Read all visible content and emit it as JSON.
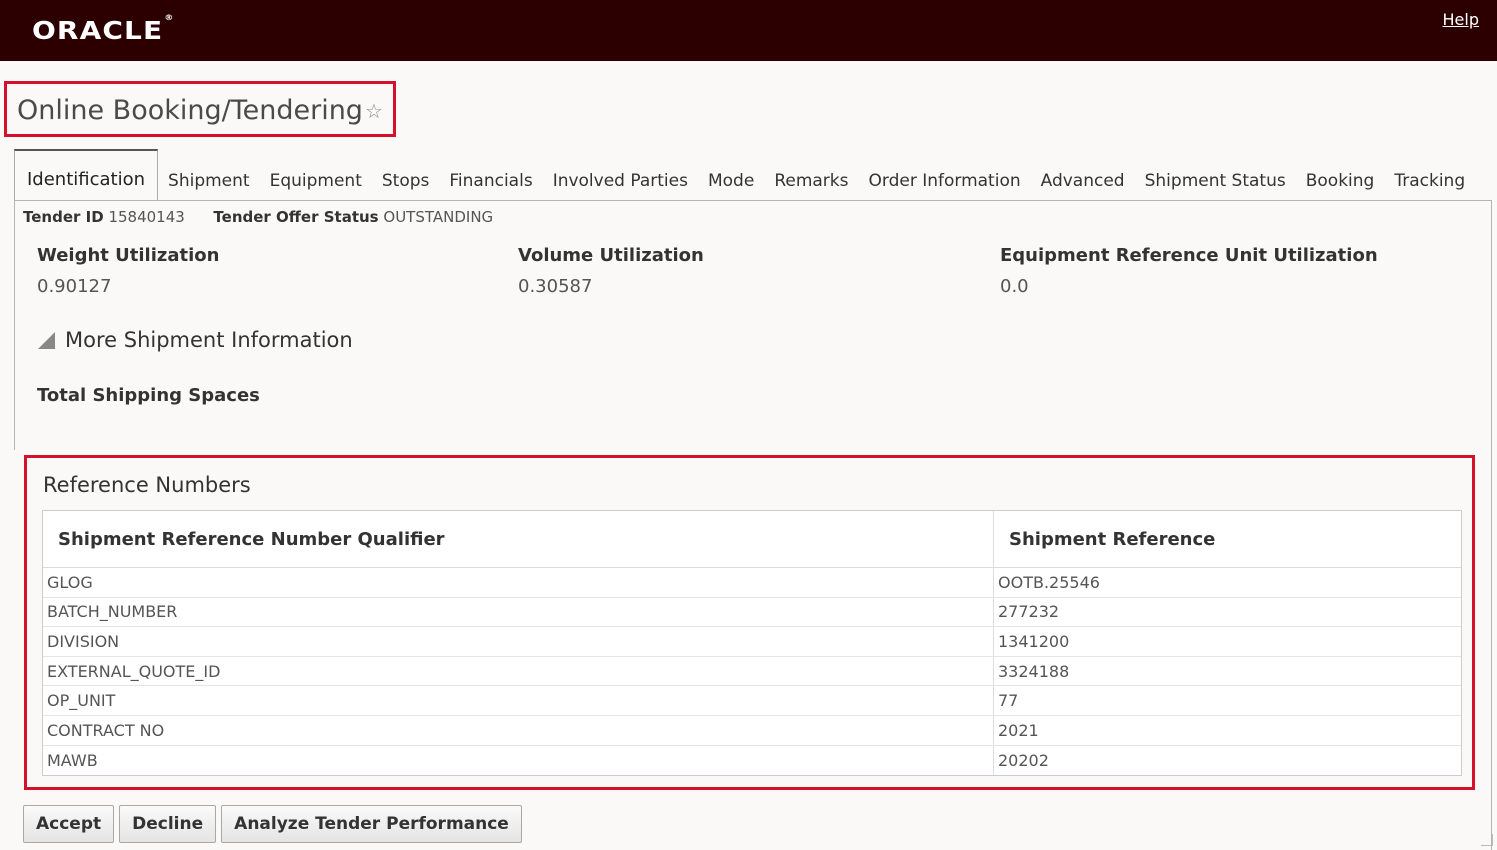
{
  "header": {
    "brand": "ORACLE",
    "brand_mark": "®",
    "help_label": "Help"
  },
  "page": {
    "title": "Online Booking/Tendering"
  },
  "tabs": [
    {
      "label": "Identification",
      "active": true
    },
    {
      "label": "Shipment"
    },
    {
      "label": "Equipment"
    },
    {
      "label": "Stops"
    },
    {
      "label": "Financials"
    },
    {
      "label": "Involved Parties"
    },
    {
      "label": "Mode"
    },
    {
      "label": "Remarks"
    },
    {
      "label": "Order Information"
    },
    {
      "label": "Advanced"
    },
    {
      "label": "Shipment Status"
    },
    {
      "label": "Booking"
    },
    {
      "label": "Tracking"
    }
  ],
  "tender": {
    "id_label": "Tender ID",
    "id_value": "15840143",
    "status_label": "Tender Offer Status",
    "status_value": "OUTSTANDING"
  },
  "utilization": {
    "weight": {
      "label": "Weight Utilization",
      "value": "0.90127"
    },
    "volume": {
      "label": "Volume Utilization",
      "value": "0.30587"
    },
    "equipment": {
      "label": "Equipment Reference Unit Utilization",
      "value": "0.0"
    }
  },
  "more_info_label": "More Shipment Information",
  "total_spaces_label": "Total Shipping Spaces",
  "reference_numbers": {
    "title": "Reference Numbers",
    "columns": [
      "Shipment Reference Number Qualifier",
      "Shipment Reference"
    ],
    "rows": [
      [
        "GLOG",
        "OOTB.25546"
      ],
      [
        "BATCH_NUMBER",
        "277232"
      ],
      [
        "DIVISION",
        "1341200"
      ],
      [
        "EXTERNAL_QUOTE_ID",
        "3324188"
      ],
      [
        "OP_UNIT",
        "77"
      ],
      [
        "CONTRACT NO",
        "2021"
      ],
      [
        "MAWB",
        "20202"
      ]
    ]
  },
  "actions": {
    "accept": "Accept",
    "decline": "Decline",
    "analyze": "Analyze Tender Performance"
  },
  "colors": {
    "header_bg": "#2c0000",
    "highlight_border": "#d5102a"
  }
}
